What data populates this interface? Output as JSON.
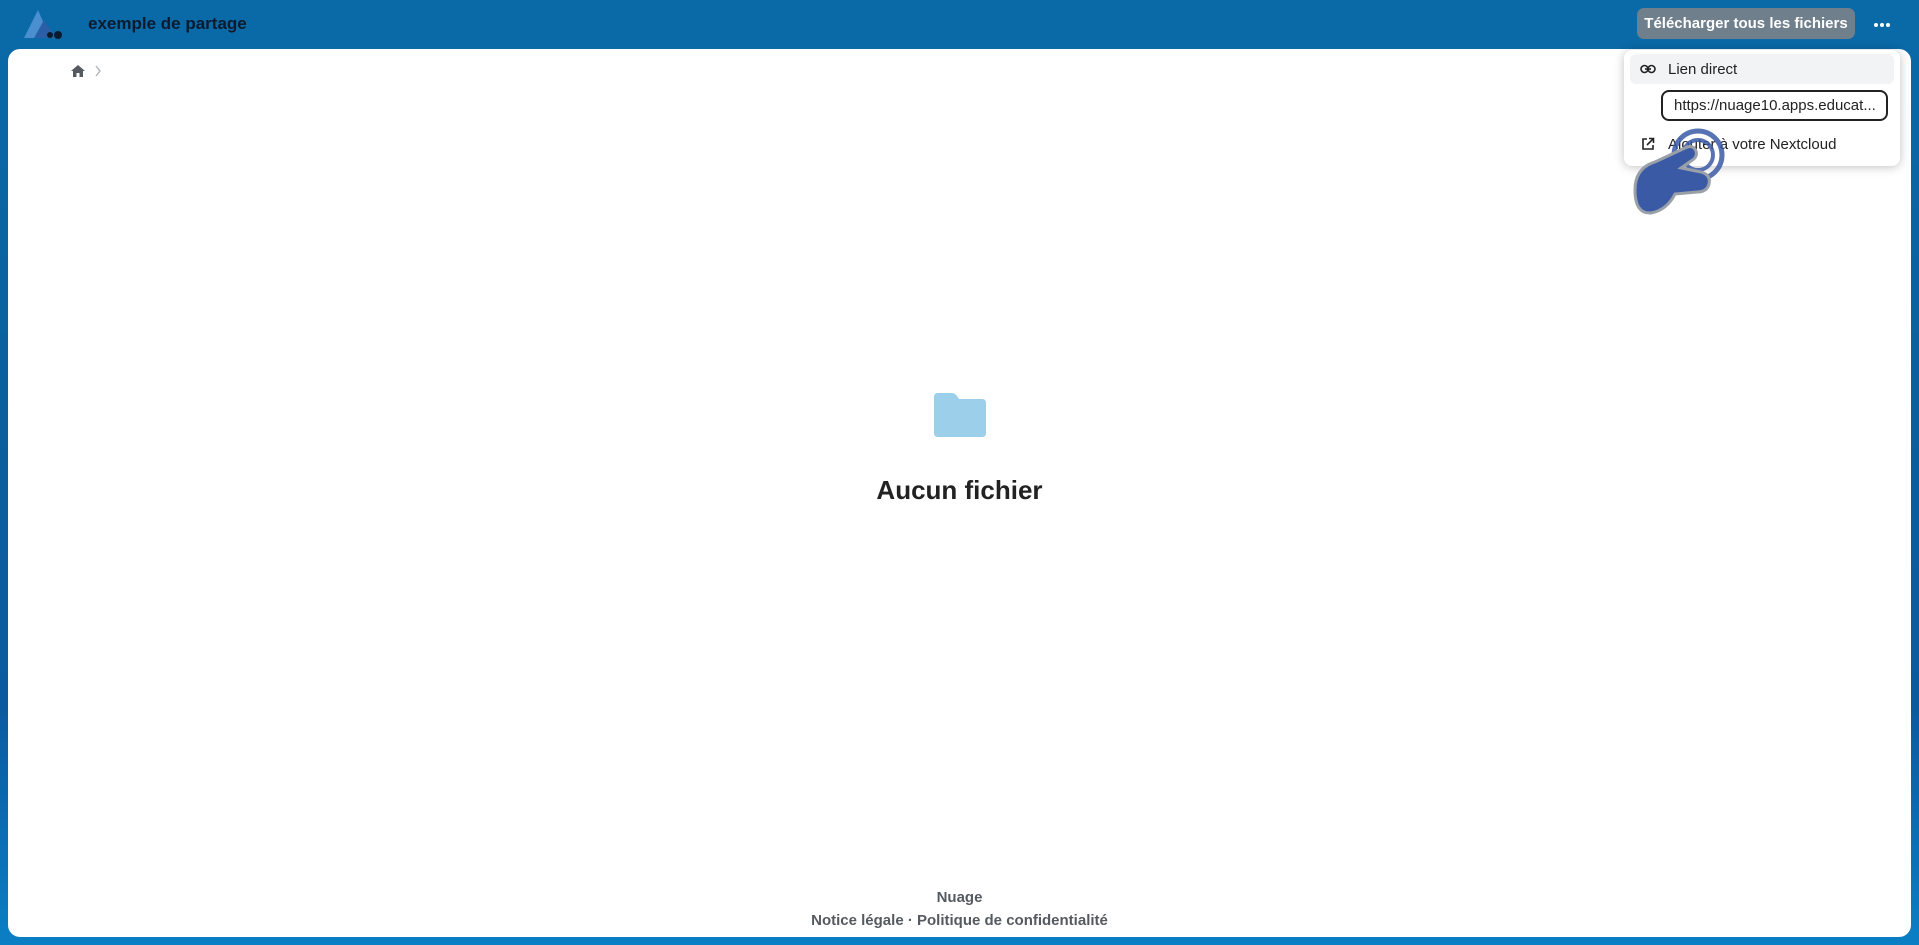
{
  "header": {
    "title": "exemple de partage",
    "download_all_label": "Télécharger tous les fichiers",
    "logo_icon": "nuage-logo-icon",
    "more_icon": "dots-horizontal-icon"
  },
  "breadcrumb": {
    "home_icon": "home-icon",
    "separator_icon": "chevron-right-icon"
  },
  "empty_state": {
    "icon": "folder-icon",
    "title": "Aucun fichier"
  },
  "popover": {
    "direct_link_label": "Lien direct",
    "direct_link_icon": "link-icon",
    "url_value": "https://nuage10.apps.educat...",
    "add_to_nextcloud_label": "Ajouter à votre Nextcloud",
    "add_icon": "external-link-icon"
  },
  "footer": {
    "name": "Nuage",
    "legal_notice": "Notice légale",
    "separator": " · ",
    "privacy_policy": "Politique de confidentialité"
  },
  "colors": {
    "header_bg": "#0a6aa8",
    "button_bg": "#6f7f8c",
    "folder": "#9ccfea",
    "hand": "#3b5aa6"
  }
}
